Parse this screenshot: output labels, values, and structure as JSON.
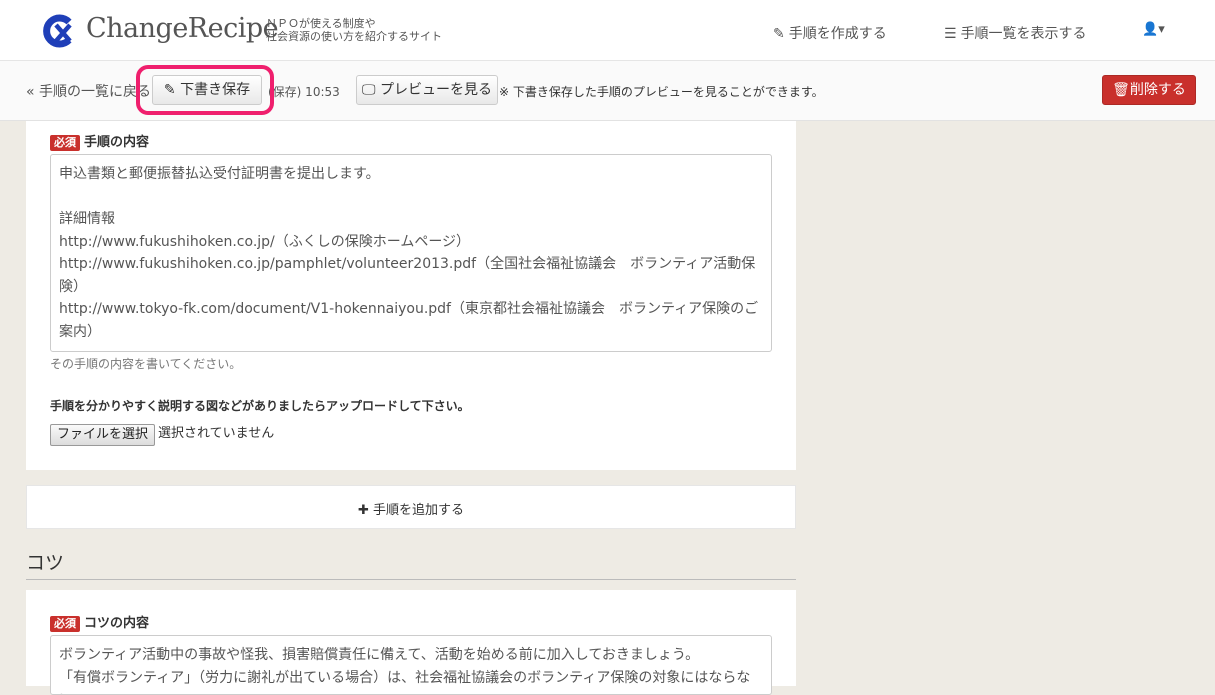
{
  "header": {
    "logo_text": "ChangeRecipe",
    "tagline_line1": "ＮＰＯが使える制度や",
    "tagline_line2": "社会資源の使い方を紹介するサイト",
    "nav": [
      {
        "label": "手順を作成する",
        "icon": "edit-icon"
      },
      {
        "label": "手順一覧を表示する",
        "icon": "list-icon"
      }
    ],
    "user_icon": "user-icon"
  },
  "toolbar": {
    "back_link": "« 手順の一覧に戻る",
    "save_button": "下書き保存",
    "save_status": "(保存) 10:53",
    "preview_button": "プレビューを見る",
    "preview_note": "※ 下書き保存した手順のプレビューを見ることができます。",
    "delete_button": "削除する"
  },
  "step": {
    "required_badge": "必須",
    "label": "手順の内容",
    "lines": [
      "申込書類と郵便振替払込受付証明書を提出します。",
      "",
      "詳細情報",
      "http://www.fukushihoken.co.jp/（ふくしの保険ホームページ）",
      "http://www.fukushihoken.co.jp/pamphlet/volunteer2013.pdf（全国社会福祉協議会　ボランティア活動保",
      "険）",
      "http://www.tokyo-fk.com/document/V1-hokennaiyou.pdf（東京都社会福祉協議会　ボランティア保険のご",
      "案内）"
    ],
    "help": "その手順の内容を書いてください。",
    "upload_label": "手順を分かりやすく説明する図などがありましたらアップロードして下さい。",
    "file_button": "ファイルを選択",
    "file_status": "選択されていません"
  },
  "add_step": "✚ 手順を追加する",
  "tips": {
    "section_title": "コツ",
    "required_badge": "必須",
    "label": "コツの内容",
    "lines": [
      "ボランティア活動中の事故や怪我、損害賠償責任に備えて、活動を始める前に加入しておきましょう。",
      "「有償ボランティア」（労力に謝礼が出ている場合）は、社会福祉協議会のボランティア保険の対象にはならない"
    ]
  },
  "colors": {
    "danger": "#c9302c",
    "highlight": "#ef1f6d",
    "logo_blue": "#1f3fb8"
  }
}
